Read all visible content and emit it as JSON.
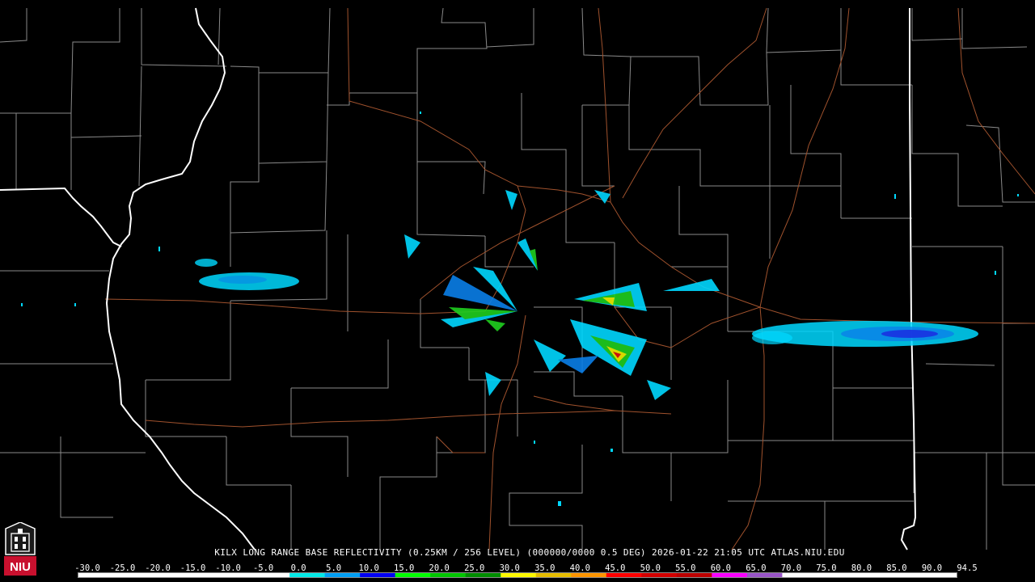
{
  "title_line": "KILX LONG RANGE BASE REFLECTIVITY (0.25KM / 256 LEVEL) (000000/0000 0.5 DEG) 2026-01-22 21:05 UTC  ATLAS.NIU.EDU",
  "logo_text": "NIU",
  "colorbar": {
    "labels": [
      "-30.0",
      "-25.0",
      "-20.0",
      "-15.0",
      "-10.0",
      "-5.0",
      "0.0",
      "5.0",
      "10.0",
      "15.0",
      "20.0",
      "25.0",
      "30.0",
      "35.0",
      "40.0",
      "45.0",
      "50.0",
      "55.0",
      "60.0",
      "65.0",
      "70.0",
      "75.0",
      "80.0",
      "85.0",
      "90.0",
      "94.5"
    ],
    "colors": [
      "#ffffff",
      "#ffffff",
      "#ffffff",
      "#ffffff",
      "#ffffff",
      "#ffffff",
      "#04e9e7",
      "#019ff4",
      "#0300f4",
      "#02fd02",
      "#01c501",
      "#008e00",
      "#fdf802",
      "#e5bc00",
      "#fd9500",
      "#fd0000",
      "#d40000",
      "#bc0000",
      "#f800fd",
      "#9854c6",
      "#fdfdfd",
      "#ffffff",
      "#ffffff",
      "#ffffff",
      "#ffffff"
    ]
  },
  "map_colors": {
    "background": "#000000",
    "county_lines": "#8a8a8a",
    "state_lines": "#ffffff",
    "highways": "#a0522d",
    "echo_light": "#00d8ff",
    "echo_mid": "#0a7fe8",
    "echo_dark": "#1a2be0",
    "echo_green": "#20d020",
    "echo_yellow": "#f0f000",
    "echo_red": "#e01010"
  }
}
